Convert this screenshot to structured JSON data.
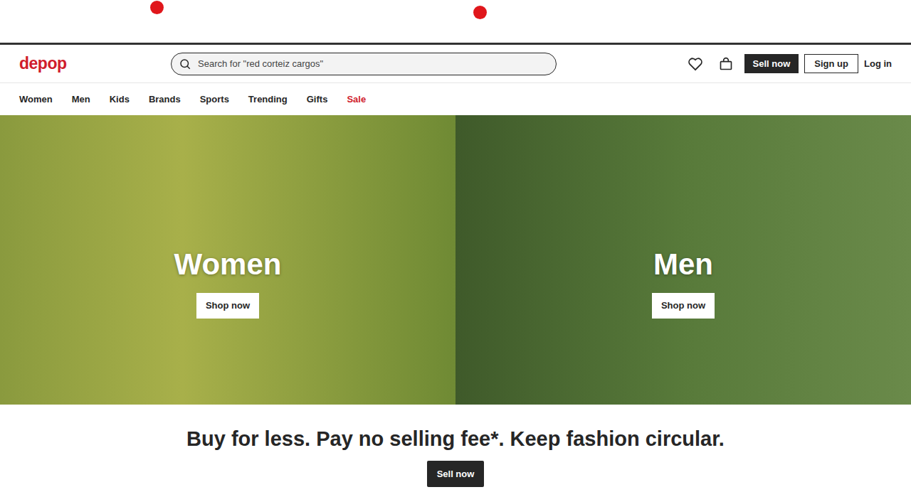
{
  "logo": "depop",
  "search": {
    "placeholder": "Search for \"red corteiz cargos\""
  },
  "header_actions": {
    "sell": "Sell now",
    "signup": "Sign up",
    "login": "Log in"
  },
  "nav": [
    {
      "label": "Women",
      "color": "#262626"
    },
    {
      "label": "Men",
      "color": "#262626"
    },
    {
      "label": "Kids",
      "color": "#262626"
    },
    {
      "label": "Brands",
      "color": "#262626"
    },
    {
      "label": "Sports",
      "color": "#262626"
    },
    {
      "label": "Trending",
      "color": "#262626"
    },
    {
      "label": "Gifts",
      "color": "#262626"
    },
    {
      "label": "Sale",
      "color": "#d01c2c"
    }
  ],
  "hero": [
    {
      "title": "Women",
      "button": "Shop now"
    },
    {
      "title": "Men",
      "button": "Shop now"
    }
  ],
  "tagline": "Buy for less. Pay no selling fee*. Keep fashion circular.",
  "cta": "Sell now"
}
